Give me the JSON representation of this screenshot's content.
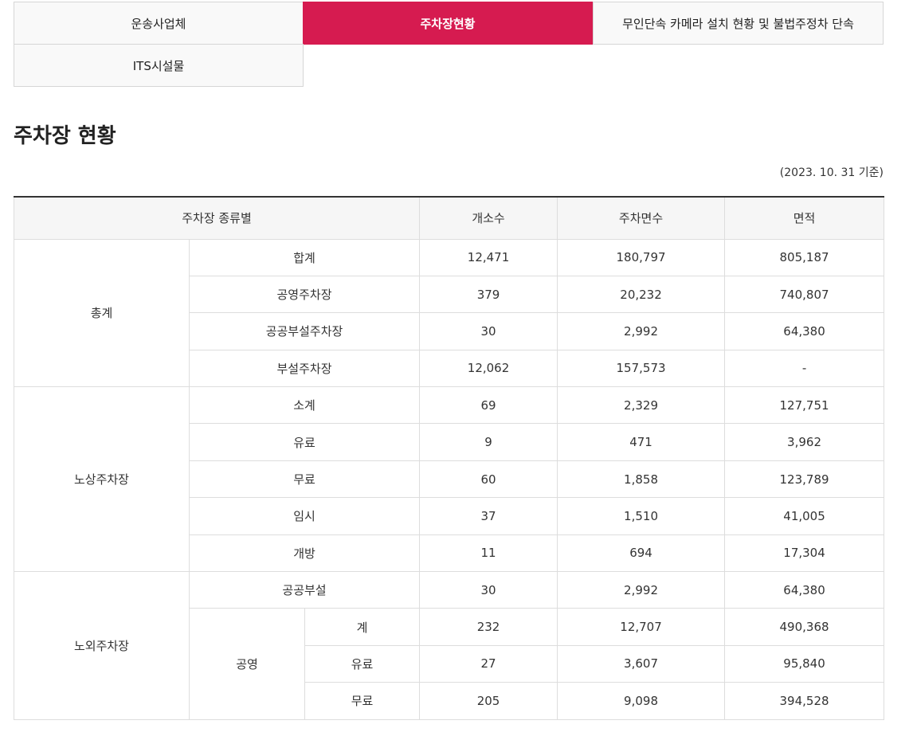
{
  "tabs": [
    {
      "label": "운송사업체",
      "active": false
    },
    {
      "label": "주차장현황",
      "active": true
    },
    {
      "label": "무인단속 카메라 설치 현황 및 불법주정차 단속",
      "active": false
    },
    {
      "label": "ITS시설물",
      "active": false
    }
  ],
  "page_title": "주차장 현황",
  "base_date": "(2023. 10. 31 기준)",
  "table": {
    "headers": [
      "주차장 종류별",
      "개소수",
      "주차면수",
      "면적"
    ],
    "groups": {
      "total": "총계",
      "onstreet": "노상주차장",
      "offstreet": "노외주차장",
      "public": "공영"
    },
    "rows": [
      {
        "label": "합계",
        "count": "12,471",
        "spaces": "180,797",
        "area": "805,187"
      },
      {
        "label": "공영주차장",
        "count": "379",
        "spaces": "20,232",
        "area": "740,807"
      },
      {
        "label": "공공부설주차장",
        "count": "30",
        "spaces": "2,992",
        "area": "64,380"
      },
      {
        "label": "부설주차장",
        "count": "12,062",
        "spaces": "157,573",
        "area": "-"
      },
      {
        "label": "소계",
        "count": "69",
        "spaces": "2,329",
        "area": "127,751"
      },
      {
        "label": "유료",
        "count": "9",
        "spaces": "471",
        "area": "3,962"
      },
      {
        "label": "무료",
        "count": "60",
        "spaces": "1,858",
        "area": "123,789"
      },
      {
        "label": "임시",
        "count": "37",
        "spaces": "1,510",
        "area": "41,005"
      },
      {
        "label": "개방",
        "count": "11",
        "spaces": "694",
        "area": "17,304"
      },
      {
        "label": "공공부설",
        "count": "30",
        "spaces": "2,992",
        "area": "64,380"
      },
      {
        "label": "계",
        "count": "232",
        "spaces": "12,707",
        "area": "490,368"
      },
      {
        "label": "유료",
        "count": "27",
        "spaces": "3,607",
        "area": "95,840"
      },
      {
        "label": "무료",
        "count": "205",
        "spaces": "9,098",
        "area": "394,528"
      }
    ]
  }
}
